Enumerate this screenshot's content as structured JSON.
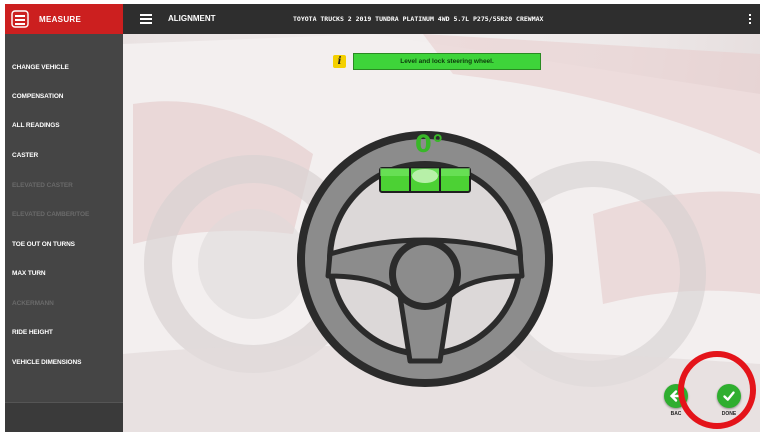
{
  "app": {
    "measure_tab": "MEASURE",
    "section_title": "ALIGNMENT",
    "vehicle_info": "TOYOTA TRUCKS 2 2019 TUNDRA PLATINUM 4WD 5.7L P275/55R20 CREWMAX"
  },
  "sidebar": {
    "items": [
      {
        "label": "CHANGE VEHICLE",
        "enabled": true
      },
      {
        "label": "COMPENSATION",
        "enabled": true
      },
      {
        "label": "ALL READINGS",
        "enabled": true
      },
      {
        "label": "CASTER",
        "enabled": true
      },
      {
        "label": "ELEVATED CASTER",
        "enabled": false
      },
      {
        "label": "ELEVATED CAMBER/TOE",
        "enabled": false
      },
      {
        "label": "TOE OUT ON TURNS",
        "enabled": true
      },
      {
        "label": "MAX TURN",
        "enabled": true
      },
      {
        "label": "ACKERMANN",
        "enabled": false
      },
      {
        "label": "RIDE HEIGHT",
        "enabled": true
      },
      {
        "label": "VEHICLE DIMENSIONS",
        "enabled": true
      }
    ]
  },
  "main": {
    "instruction": "Level and lock steering wheel.",
    "info_icon_glyph": "i",
    "steering_angle": "0°",
    "back_label": "BAC",
    "done_label": "DONE"
  },
  "icons": {
    "measure": "measure-icon",
    "menu": "hamburger-menu-icon",
    "more": "kebab-menu-icon",
    "info": "info-icon",
    "back": "back-arrow-icon",
    "done": "checkmark-icon"
  },
  "colors": {
    "accent_red": "#cc1f1f",
    "ok_green": "#3ed43a",
    "highlight_ring": "#e4141a"
  }
}
